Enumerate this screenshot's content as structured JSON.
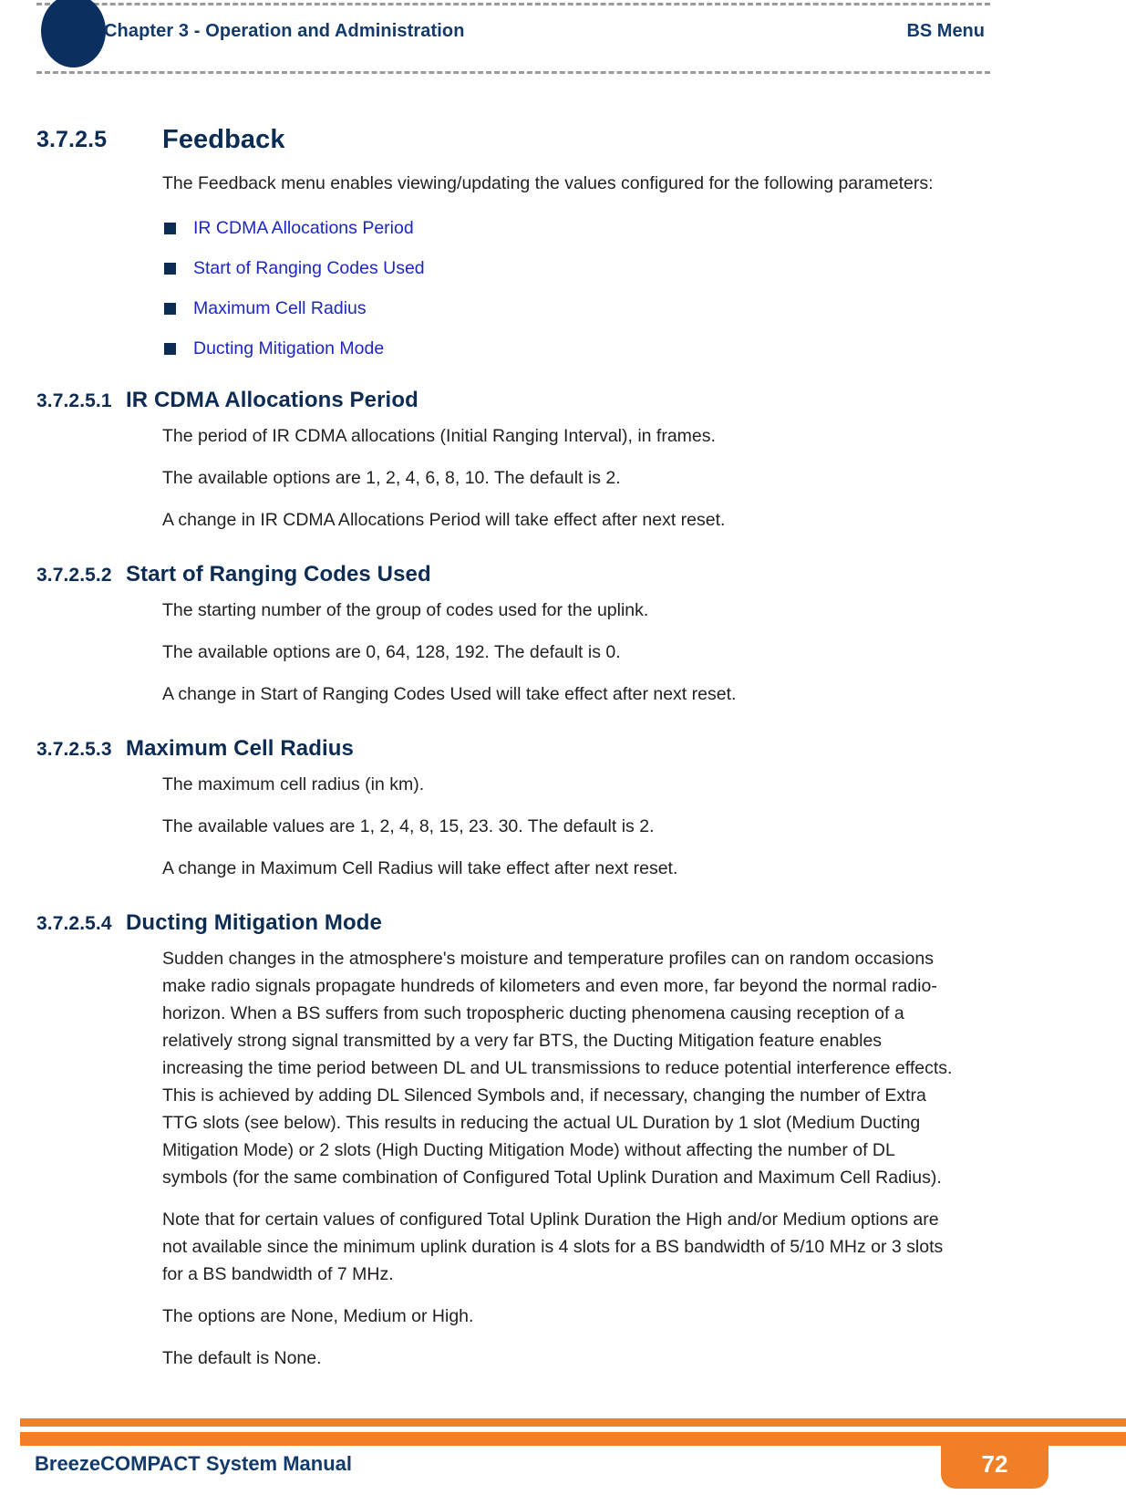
{
  "header": {
    "chapter": "Chapter 3 - Operation and Administration",
    "section": "BS Menu"
  },
  "sections": {
    "feedback": {
      "number": "3.7.2.5",
      "title": "Feedback",
      "intro": "The Feedback menu enables viewing/updating the values configured for the following parameters:",
      "links": [
        "IR CDMA Allocations Period",
        "Start of Ranging Codes Used",
        "Maximum Cell Radius",
        "Ducting Mitigation Mode"
      ]
    },
    "ir_cdma": {
      "number": "3.7.2.5.1",
      "title": "IR CDMA Allocations Period",
      "p1": "The period of IR CDMA allocations (Initial Ranging Interval), in frames.",
      "p2": "The available options are 1, 2, 4, 6, 8, 10. The default is 2.",
      "p3": "A change in IR CDMA Allocations Period will take effect after next reset."
    },
    "ranging_codes": {
      "number": "3.7.2.5.2",
      "title": "Start of Ranging Codes Used",
      "p1": "The starting number of the group of codes used for the uplink.",
      "p2": "The available options are 0, 64, 128, 192. The default is 0.",
      "p3": "A change in Start of Ranging Codes Used will take effect after next reset."
    },
    "cell_radius": {
      "number": "3.7.2.5.3",
      "title": "Maximum Cell Radius",
      "p1": "The maximum cell radius (in km).",
      "p2": "The available values are 1, 2, 4, 8, 15, 23. 30. The default is 2.",
      "p3": "A change in Maximum Cell Radius will take effect after next reset."
    },
    "ducting": {
      "number": "3.7.2.5.4",
      "title": "Ducting Mitigation Mode",
      "p1": "Sudden changes in the atmosphere's moisture and temperature profiles can on random occasions make radio signals propagate hundreds of kilometers and even more, far beyond the normal radio-horizon. When a BS suffers from such tropospheric ducting phenomena causing reception of a relatively strong signal transmitted by a very far BTS, the Ducting Mitigation feature enables increasing the time period between DL and UL transmissions to reduce potential interference effects. This is achieved by adding DL Silenced Symbols and, if necessary, changing the number of Extra TTG slots (see below). This results in reducing the actual UL Duration by 1 slot (Medium Ducting Mitigation Mode) or 2 slots (High Ducting Mitigation Mode) without affecting the number of DL symbols (for the same combination of Configured Total Uplink Duration and Maximum Cell Radius).",
      "p2": "Note that for certain values of configured Total Uplink Duration the High and/or Medium options are not available since the minimum uplink duration is 4 slots for a BS bandwidth of 5/10 MHz or 3 slots for a BS bandwidth of 7 MHz.",
      "p3": "The options are None, Medium or High.",
      "p4": "The default is None."
    }
  },
  "footer": {
    "title": "BreezeCOMPACT System Manual",
    "page_number": "72"
  },
  "colors": {
    "navy": "#0d2c54",
    "header_blue": "#123a6b",
    "link_blue": "#1c27c4",
    "orange": "#f07f27",
    "body_text": "#231f20"
  }
}
